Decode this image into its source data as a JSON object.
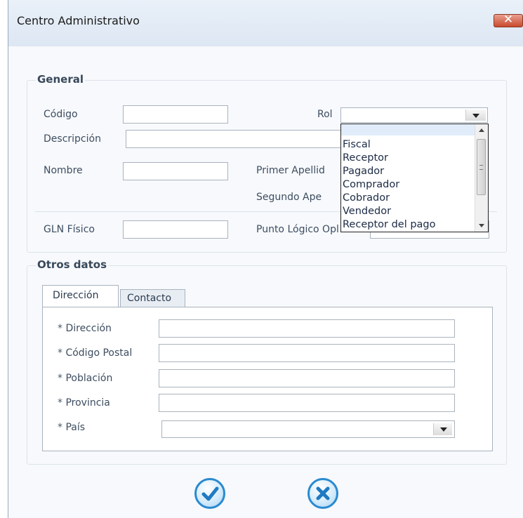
{
  "window": {
    "title": "Centro Administrativo",
    "close_label": "✕"
  },
  "general": {
    "title": "General",
    "codigo_label": "Código",
    "codigo_value": "",
    "descripcion_label": "Descripción",
    "descripcion_value": "",
    "nombre_label": "Nombre",
    "nombre_value": "",
    "primer_apellido_label": "Primer Apellid",
    "segundo_apellido_label": "Segundo Ape",
    "gln_fisico_label": "GLN Físico",
    "gln_fisico_value": "",
    "punto_logico_label": "Punto Lógico Opl",
    "rol_label": "Rol",
    "rol_value": "",
    "rol_options": [
      "",
      "Fiscal",
      "Receptor",
      "Pagador",
      "Comprador",
      "Cobrador",
      "Vendedor",
      "Receptor del pago"
    ]
  },
  "otros": {
    "title": "Otros datos",
    "tabs": [
      "Dirección",
      "Contacto"
    ],
    "direccion_label": "Dirección",
    "codigo_postal_label": "Código Postal",
    "poblacion_label": "Población",
    "provincia_label": "Provincia",
    "pais_label": "País",
    "required_mark": "*"
  },
  "icons": {
    "accept": "check-circle-icon",
    "cancel": "x-circle-icon"
  },
  "colors": {
    "accent": "#2a8ad0",
    "close": "#c9492e"
  }
}
